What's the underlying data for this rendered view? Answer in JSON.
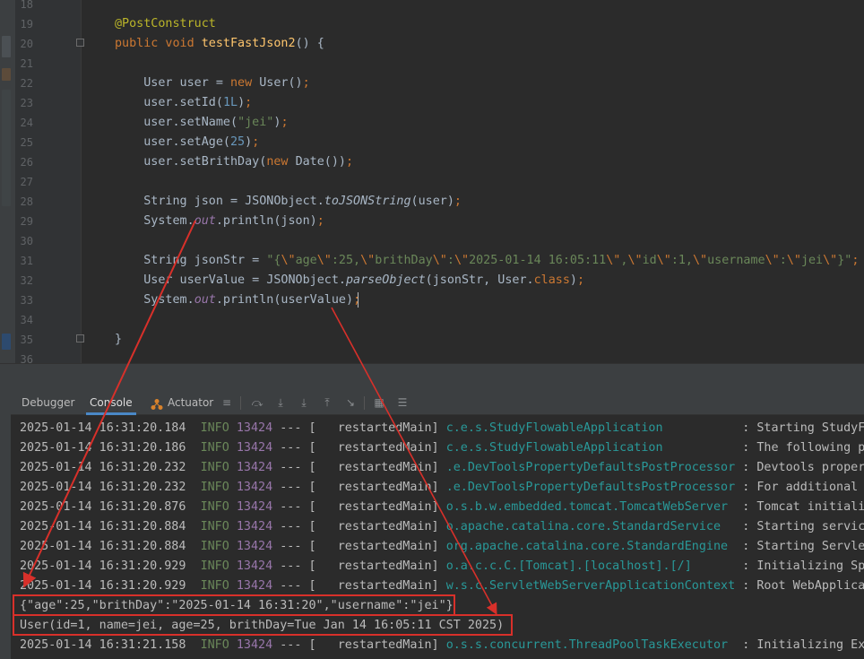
{
  "editor": {
    "accent_colors": {
      "keyword": "#cc7832",
      "annotation": "#bbb529",
      "string": "#6a8759",
      "number": "#6897bb",
      "method": "#ffc66d",
      "field": "#9876aa"
    },
    "line_numbers": [
      "18",
      "19",
      "20",
      "21",
      "22",
      "23",
      "24",
      "25",
      "26",
      "27",
      "28",
      "29",
      "30",
      "31",
      "32",
      "33",
      "34",
      "35",
      "36"
    ],
    "lines": [
      [],
      [
        {
          "c": "ann",
          "t": "@PostConstruct"
        }
      ],
      [
        {
          "c": "kw",
          "t": "public void "
        },
        {
          "c": "fn",
          "t": "testFastJson2"
        },
        {
          "c": "",
          "t": "() {"
        }
      ],
      [],
      [
        {
          "c": "",
          "t": "    User user = "
        },
        {
          "c": "kw",
          "t": "new "
        },
        {
          "c": "",
          "t": "User()"
        },
        {
          "c": "kw",
          "t": ";"
        }
      ],
      [
        {
          "c": "",
          "t": "    user.setId("
        },
        {
          "c": "num",
          "t": "1L"
        },
        {
          "c": "",
          "t": ")"
        },
        {
          "c": "kw",
          "t": ";"
        }
      ],
      [
        {
          "c": "",
          "t": "    user.setName("
        },
        {
          "c": "str",
          "t": "\"jei\""
        },
        {
          "c": "",
          "t": ")"
        },
        {
          "c": "kw",
          "t": ";"
        }
      ],
      [
        {
          "c": "",
          "t": "    user.setAge("
        },
        {
          "c": "num",
          "t": "25"
        },
        {
          "c": "",
          "t": ")"
        },
        {
          "c": "kw",
          "t": ";"
        }
      ],
      [
        {
          "c": "",
          "t": "    user.setBrithDay("
        },
        {
          "c": "kw",
          "t": "new "
        },
        {
          "c": "",
          "t": "Date())"
        },
        {
          "c": "kw",
          "t": ";"
        }
      ],
      [],
      [
        {
          "c": "",
          "t": "    String json = JSONObject."
        },
        {
          "c": "it",
          "t": "toJSONString"
        },
        {
          "c": "",
          "t": "(user)"
        },
        {
          "c": "kw",
          "t": ";"
        }
      ],
      [
        {
          "c": "",
          "t": "    System."
        },
        {
          "c": "fld",
          "t": "out"
        },
        {
          "c": "",
          "t": ".println(json)"
        },
        {
          "c": "kw",
          "t": ";"
        }
      ],
      [],
      [
        {
          "c": "",
          "t": "    String jsonStr = "
        },
        {
          "c": "str",
          "t": "\"{"
        },
        {
          "c": "kw",
          "t": "\\\""
        },
        {
          "c": "str",
          "t": "age"
        },
        {
          "c": "kw",
          "t": "\\\""
        },
        {
          "c": "str",
          "t": ":25,"
        },
        {
          "c": "kw",
          "t": "\\\""
        },
        {
          "c": "str",
          "t": "brithDay"
        },
        {
          "c": "kw",
          "t": "\\\""
        },
        {
          "c": "str",
          "t": ":"
        },
        {
          "c": "kw",
          "t": "\\\""
        },
        {
          "c": "str",
          "t": "2025-01-14 16:05:11"
        },
        {
          "c": "kw",
          "t": "\\\""
        },
        {
          "c": "str",
          "t": ","
        },
        {
          "c": "kw",
          "t": "\\\""
        },
        {
          "c": "str",
          "t": "id"
        },
        {
          "c": "kw",
          "t": "\\\""
        },
        {
          "c": "str",
          "t": ":1,"
        },
        {
          "c": "kw",
          "t": "\\\""
        },
        {
          "c": "str",
          "t": "username"
        },
        {
          "c": "kw",
          "t": "\\\""
        },
        {
          "c": "str",
          "t": ":"
        },
        {
          "c": "kw",
          "t": "\\\""
        },
        {
          "c": "str",
          "t": "jei"
        },
        {
          "c": "kw",
          "t": "\\\""
        },
        {
          "c": "str",
          "t": "}\""
        },
        {
          "c": "kw",
          "t": ";"
        }
      ],
      [
        {
          "c": "",
          "t": "    User userValue = JSONObject."
        },
        {
          "c": "it",
          "t": "parseObject"
        },
        {
          "c": "",
          "t": "(jsonStr, User."
        },
        {
          "c": "kw",
          "t": "class"
        },
        {
          "c": "",
          "t": ")"
        },
        {
          "c": "kw",
          "t": ";"
        }
      ],
      [
        {
          "c": "",
          "t": "    System."
        },
        {
          "c": "fld",
          "t": "out"
        },
        {
          "c": "",
          "t": ".println(userValue)"
        },
        {
          "c": "kw",
          "t": ";"
        }
      ],
      [],
      [
        {
          "c": "",
          "t": "}"
        }
      ],
      []
    ]
  },
  "tool_window": {
    "tabs": [
      "Debugger",
      "Console",
      "Actuator"
    ],
    "active_tab": "Console",
    "toolbar_icons": [
      "list-icon",
      "step-over-icon",
      "step-into-icon",
      "force-step-into-icon",
      "step-out-icon",
      "run-to-cursor-icon",
      "frames-icon",
      "threads-icon"
    ]
  },
  "console": {
    "lines": [
      {
        "type": "log",
        "date": "2025-01-14 16:31:20.184",
        "level": "INFO",
        "pid": "13424",
        "sep": "--- [",
        "thread": "  restartedMain]",
        "logger": "c.e.s.StudyFlowableApplication          ",
        "msg": ": Starting StudyFlowableApplication"
      },
      {
        "type": "log",
        "date": "2025-01-14 16:31:20.186",
        "level": "INFO",
        "pid": "13424",
        "sep": "--- [",
        "thread": "  restartedMain]",
        "logger": "c.e.s.StudyFlowableApplication          ",
        "msg": ": The following profiles"
      },
      {
        "type": "log",
        "date": "2025-01-14 16:31:20.232",
        "level": "INFO",
        "pid": "13424",
        "sep": "--- [",
        "thread": "  restartedMain]",
        "logger": ".e.DevToolsPropertyDefaultsPostProcessor",
        "msg": ": Devtools property"
      },
      {
        "type": "log",
        "date": "2025-01-14 16:31:20.232",
        "level": "INFO",
        "pid": "13424",
        "sep": "--- [",
        "thread": "  restartedMain]",
        "logger": ".e.DevToolsPropertyDefaultsPostProcessor",
        "msg": ": For additional web"
      },
      {
        "type": "log",
        "date": "2025-01-14 16:31:20.876",
        "level": "INFO",
        "pid": "13424",
        "sep": "--- [",
        "thread": "  restartedMain]",
        "logger": "o.s.b.w.embedded.tomcat.TomcatWebServer ",
        "msg": ": Tomcat initialized"
      },
      {
        "type": "log",
        "date": "2025-01-14 16:31:20.884",
        "level": "INFO",
        "pid": "13424",
        "sep": "--- [",
        "thread": "  restartedMain]",
        "logger": "o.apache.catalina.core.StandardService  ",
        "msg": ": Starting service"
      },
      {
        "type": "log",
        "date": "2025-01-14 16:31:20.884",
        "level": "INFO",
        "pid": "13424",
        "sep": "--- [",
        "thread": "  restartedMain]",
        "logger": "org.apache.catalina.core.StandardEngine ",
        "msg": ": Starting Servlet"
      },
      {
        "type": "log",
        "date": "2025-01-14 16:31:20.929",
        "level": "INFO",
        "pid": "13424",
        "sep": "--- [",
        "thread": "  restartedMain]",
        "logger": "o.a.c.c.C.[Tomcat].[localhost].[/]      ",
        "msg": ": Initializing Spring"
      },
      {
        "type": "log",
        "date": "2025-01-14 16:31:20.929",
        "level": "INFO",
        "pid": "13424",
        "sep": "--- [",
        "thread": "  restartedMain]",
        "logger": "w.s.c.ServletWebServerApplicationContext",
        "msg": ": Root WebApplicationContext"
      },
      {
        "type": "out",
        "text": "{\"age\":25,\"brithDay\":\"2025-01-14 16:31:20\",\"username\":\"jei\"}"
      },
      {
        "type": "out",
        "text": "User(id=1, name=jei, age=25, brithDay=Tue Jan 14 16:05:11 CST 2025)"
      },
      {
        "type": "log",
        "date": "2025-01-14 16:31:21.158",
        "level": "INFO",
        "pid": "13424",
        "sep": "--- [",
        "thread": "  restartedMain]",
        "logger": "o.s.s.concurrent.ThreadPoolTaskExecutor ",
        "msg": ": Initializing ExecutorService"
      }
    ]
  },
  "annotation_color": "#d8302a"
}
